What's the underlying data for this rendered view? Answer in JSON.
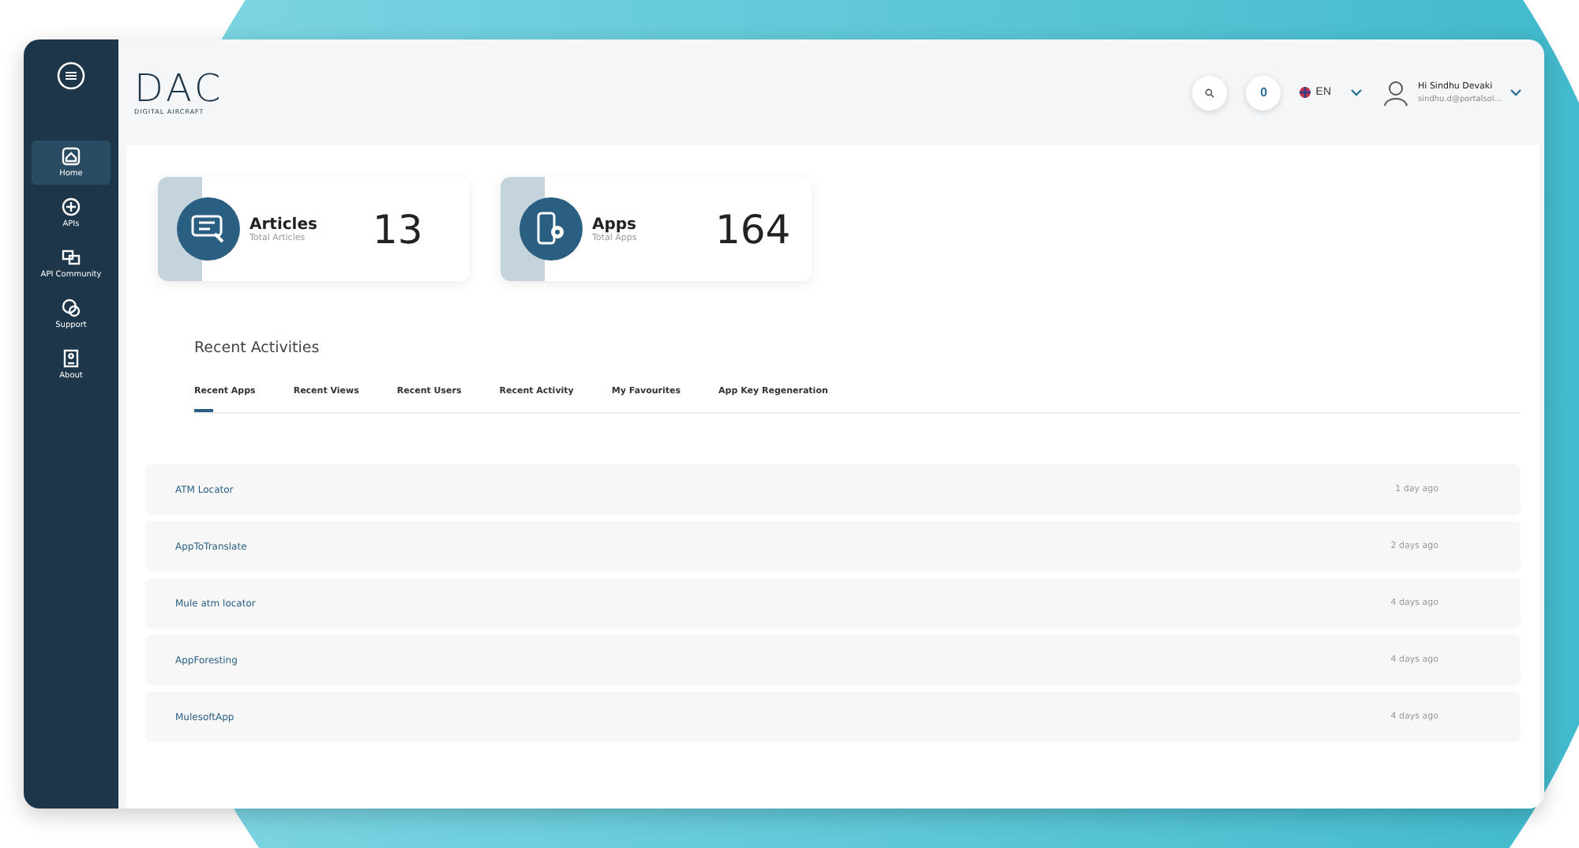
{
  "logo": {
    "title": "DAC",
    "subtitle": "DIGITAL AIRCRAFT"
  },
  "sidebar": {
    "items": [
      {
        "label": "Home",
        "selected": true
      },
      {
        "label": "APIs",
        "selected": false
      },
      {
        "label": "API Community",
        "selected": false
      },
      {
        "label": "Support",
        "selected": false
      },
      {
        "label": "About",
        "selected": false
      }
    ]
  },
  "header": {
    "notifications": "0",
    "language": "EN",
    "user": {
      "greeting": "Hi Sindhu Devaki",
      "email": "sindhu.d@portalsol..."
    }
  },
  "stats": [
    {
      "title": "Articles",
      "subtitle": "Total Articles",
      "value": "13"
    },
    {
      "title": "Apps",
      "subtitle": "Total Apps",
      "value": "164"
    }
  ],
  "recent": {
    "title": "Recent Activities",
    "tabs": [
      {
        "label": "Recent Apps",
        "selected": true
      },
      {
        "label": "Recent Views",
        "selected": false
      },
      {
        "label": "Recent Users",
        "selected": false
      },
      {
        "label": "Recent Activity",
        "selected": false
      },
      {
        "label": "My Favourites",
        "selected": false
      },
      {
        "label": "App Key Regeneration",
        "selected": false
      }
    ],
    "rows": [
      {
        "name": "ATM Locator",
        "time": "1 day ago"
      },
      {
        "name": "AppToTranslate",
        "time": "2 days ago"
      },
      {
        "name": "Mule atm locator",
        "time": "4 days ago"
      },
      {
        "name": "AppForesting",
        "time": "4 days ago"
      },
      {
        "name": "MulesoftApp",
        "time": "4 days ago"
      }
    ]
  }
}
